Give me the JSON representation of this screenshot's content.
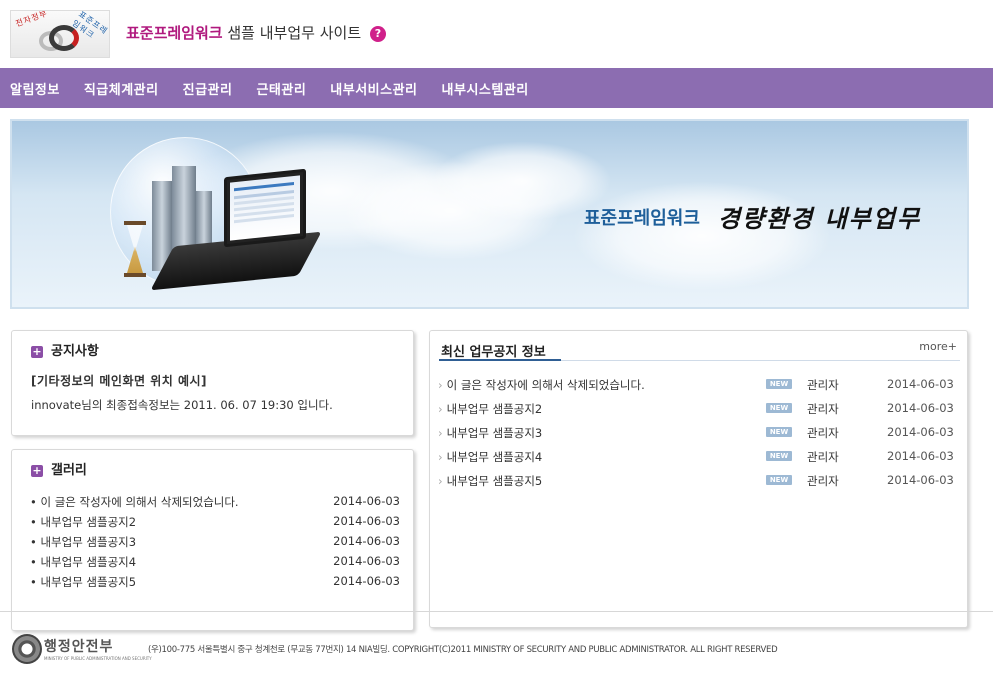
{
  "header": {
    "logo_text_left": "전자정부",
    "logo_text_right": "표준프레임워크",
    "title_brand": "표준프레임워크",
    "title_rest": " 샘플 내부업무 사이트",
    "help_icon": "question-mark-icon"
  },
  "nav": {
    "items": [
      "알림정보",
      "직급체계관리",
      "진급관리",
      "근태관리",
      "내부서비스관리",
      "내부시스템관리"
    ]
  },
  "banner": {
    "text1": "표준프레임워크",
    "text2": "경량환경 내부업무"
  },
  "notice": {
    "title": "공지사항",
    "headline": "[기타정보의 메인화면 위치 예시]",
    "body": "innovate님의 최종접속정보는 2011. 06. 07 19:30 입니다."
  },
  "gallery": {
    "title": "갤러리",
    "items": [
      {
        "title": "이 글은 작성자에 의해서 삭제되었습니다.",
        "date": "2014-06-03"
      },
      {
        "title": "내부업무 샘플공지2",
        "date": "2014-06-03"
      },
      {
        "title": "내부업무 샘플공지3",
        "date": "2014-06-03"
      },
      {
        "title": "내부업무 샘플공지4",
        "date": "2014-06-03"
      },
      {
        "title": "내부업무 샘플공지5",
        "date": "2014-06-03"
      }
    ]
  },
  "latest": {
    "title": "최신 업무공지 정보",
    "more": "more+",
    "items": [
      {
        "title": "이 글은 작성자에 의해서 삭제되었습니다.",
        "badge": "NEW",
        "author": "관리자",
        "date": "2014-06-03"
      },
      {
        "title": "내부업무 샘플공지2",
        "badge": "NEW",
        "author": "관리자",
        "date": "2014-06-03"
      },
      {
        "title": "내부업무 샘플공지3",
        "badge": "NEW",
        "author": "관리자",
        "date": "2014-06-03"
      },
      {
        "title": "내부업무 샘플공지4",
        "badge": "NEW",
        "author": "관리자",
        "date": "2014-06-03"
      },
      {
        "title": "내부업무 샘플공지5",
        "badge": "NEW",
        "author": "관리자",
        "date": "2014-06-03"
      }
    ]
  },
  "footer": {
    "ministry": "행정안전부",
    "ministry_en": "MINISTRY OF PUBLIC ADMINISTRATION AND SECURITY",
    "copyright": "(우)100-775 서울특별시 중구 청계천로 (무교동 77번지) 14 NIA빌딩. COPYRIGHT(C)2011 MINISTRY OF SECURITY AND PUBLIC ADMINISTRATOR. ALL RIGHT RESERVED"
  },
  "colors": {
    "nav_bg": "#8c6db1",
    "brand_magenta": "#b0197e",
    "panel_accent": "#8b4ea6",
    "link_blue": "#2f5e94"
  }
}
